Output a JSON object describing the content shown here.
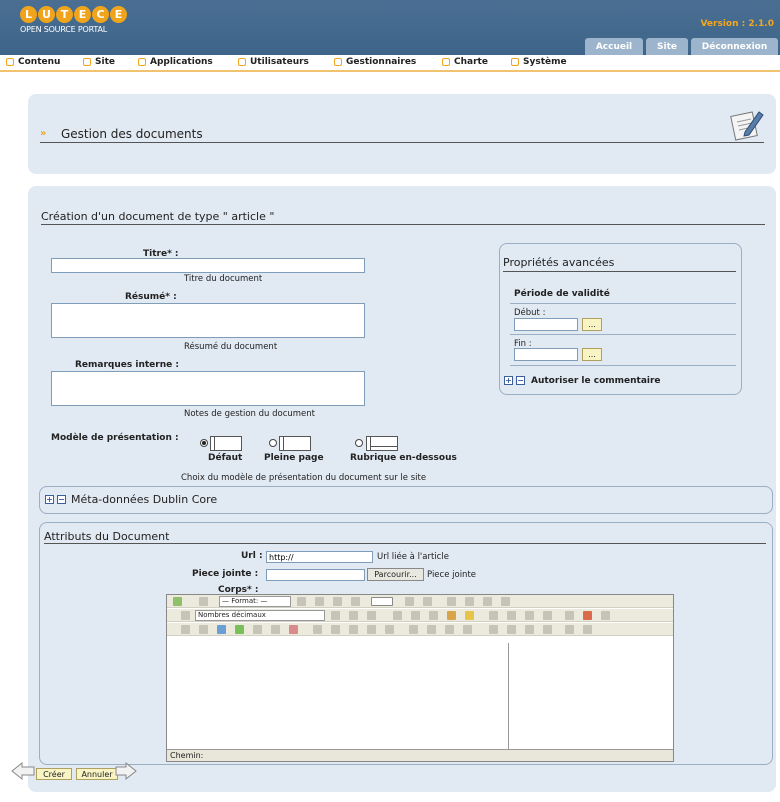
{
  "header": {
    "logo_letters": [
      "L",
      "U",
      "T",
      "E",
      "C",
      "E"
    ],
    "logo_subtitle": "OPEN SOURCE PORTAL",
    "version": "Version : 2.1.0",
    "tabs": [
      "Accueil",
      "Site",
      "Déconnexion"
    ]
  },
  "menu": [
    "Contenu",
    "Site",
    "Applications",
    "Utilisateurs",
    "Gestionnaires",
    "Charte",
    "Système"
  ],
  "page_title": "Gestion des documents",
  "form": {
    "title": "Création d'un document de type \" article \"",
    "titre_label": "Titre* :",
    "titre_hint": "Titre du document",
    "resume_label": "Résumé* :",
    "resume_hint": "Résumé du document",
    "remarques_label": "Remarques interne :",
    "remarques_hint": "Notes de gestion du document",
    "modele_label": "Modèle de présentation :",
    "modele_options": [
      "Défaut",
      "Pleine page",
      "Rubrique en-dessous"
    ],
    "modele_hint": "Choix du modèle de présentation du document sur le site"
  },
  "advanced": {
    "title": "Propriétés avancées",
    "validity": "Période de validité",
    "debut_label": "Début :",
    "fin_label": "Fin :",
    "date_btn": "...",
    "comment_label": "Autoriser le commentaire"
  },
  "dublin_core": "Méta-données Dublin Core",
  "attributes": {
    "title": "Attributs du Document",
    "url_label": "Url :",
    "url_value": "http://",
    "url_hint": "Url liée à l'article",
    "piece_label": "Piece jointe :",
    "browse_label": "Parcourir...",
    "piece_hint": "Piece jointe",
    "corps_label": "Corps* :"
  },
  "editor": {
    "format_select": "— Format: —",
    "list_select": "Nombres décimaux",
    "status": "Chemin:"
  },
  "actions": {
    "create": "Créer",
    "cancel": "Annuler"
  }
}
